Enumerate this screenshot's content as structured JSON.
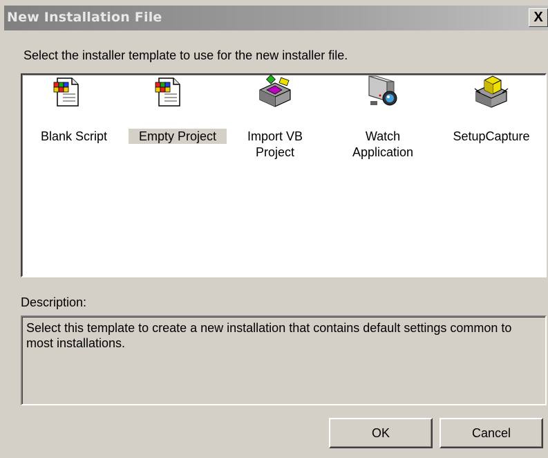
{
  "window": {
    "title": "New Installation File",
    "close_label": "X"
  },
  "prompt": "Select the installer template to use for the new installer file.",
  "templates": [
    {
      "label": "Blank Script",
      "icon": "script-document-icon",
      "selected": false
    },
    {
      "label": "Empty Project",
      "icon": "project-document-icon",
      "selected": true
    },
    {
      "label_line1": "Import VB",
      "label_line2": "Project",
      "icon": "import-box-icon",
      "selected": false
    },
    {
      "label_line1": "Watch",
      "label_line2": "Application",
      "icon": "camera-icon",
      "selected": false
    },
    {
      "label": "SetupCapture",
      "icon": "capture-box-icon",
      "selected": false
    }
  ],
  "description": {
    "label": "Description:",
    "text": "Select this template to create a new installation that contains default settings common to most installations."
  },
  "buttons": {
    "ok": "OK",
    "cancel": "Cancel"
  }
}
